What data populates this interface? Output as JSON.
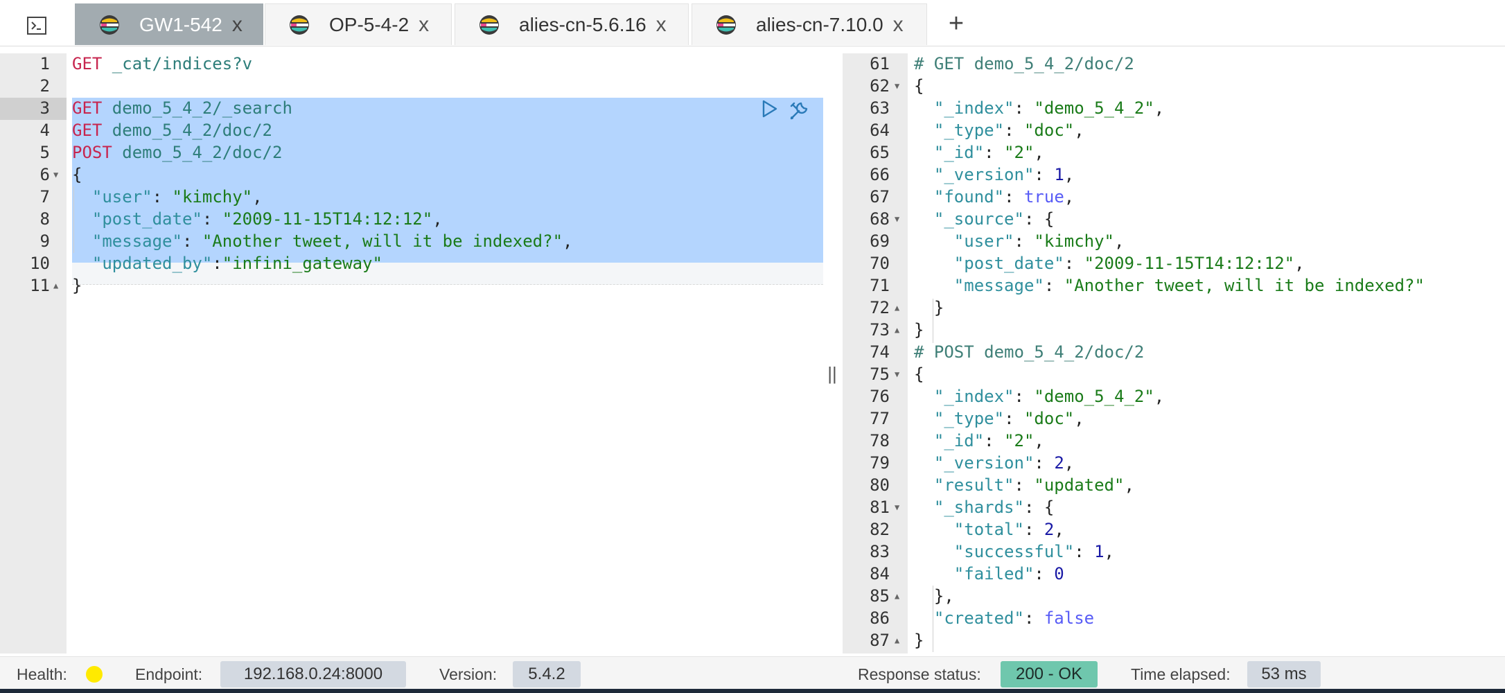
{
  "tabs": [
    {
      "label": "GW1-542",
      "active": true
    },
    {
      "label": "OP-5-4-2",
      "active": false
    },
    {
      "label": "alies-cn-5.6.16",
      "active": false
    },
    {
      "label": "alies-cn-7.10.0",
      "active": false
    }
  ],
  "tab_close_glyph": "x",
  "add_tab_glyph": "+",
  "request_editor": {
    "lines": [
      {
        "n": "1",
        "tokens": [
          [
            "method",
            "GET"
          ],
          [
            "url",
            " _cat/indices?v"
          ]
        ]
      },
      {
        "n": "2",
        "tokens": []
      },
      {
        "n": "3",
        "tokens": [
          [
            "method",
            "GET"
          ],
          [
            "url",
            " demo_5_4_2/_search"
          ]
        ]
      },
      {
        "n": "4",
        "tokens": [
          [
            "method",
            "GET"
          ],
          [
            "url",
            " demo_5_4_2/doc/2"
          ]
        ]
      },
      {
        "n": "5",
        "tokens": [
          [
            "method",
            "POST"
          ],
          [
            "url",
            " demo_5_4_2/doc/2"
          ]
        ]
      },
      {
        "n": "6",
        "fold": "open",
        "tokens": [
          [
            "punc",
            "{"
          ]
        ]
      },
      {
        "n": "7",
        "tokens": [
          [
            "punc",
            "  "
          ],
          [
            "key",
            "\"user\""
          ],
          [
            "punc",
            ": "
          ],
          [
            "str",
            "\"kimchy\""
          ],
          [
            "punc",
            ","
          ]
        ]
      },
      {
        "n": "8",
        "tokens": [
          [
            "punc",
            "  "
          ],
          [
            "key",
            "\"post_date\""
          ],
          [
            "punc",
            ": "
          ],
          [
            "str",
            "\"2009-11-15T14:12:12\""
          ],
          [
            "punc",
            ","
          ]
        ]
      },
      {
        "n": "9",
        "tokens": [
          [
            "punc",
            "  "
          ],
          [
            "key",
            "\"message\""
          ],
          [
            "punc",
            ": "
          ],
          [
            "str",
            "\"Another tweet, will it be indexed?\""
          ],
          [
            "punc",
            ","
          ]
        ]
      },
      {
        "n": "10",
        "tokens": [
          [
            "punc",
            "  "
          ],
          [
            "key",
            "\"updated_by\""
          ],
          [
            "punc",
            ":"
          ],
          [
            "str",
            "\"infini_gateway\""
          ]
        ]
      },
      {
        "n": "11",
        "fold": "close",
        "tokens": [
          [
            "punc",
            "}"
          ]
        ]
      }
    ]
  },
  "response_editor": {
    "lines": [
      {
        "n": "61",
        "tokens": [
          [
            "comment",
            "# GET demo_5_4_2/doc/2"
          ]
        ]
      },
      {
        "n": "62",
        "fold": "open",
        "tokens": [
          [
            "punc",
            "{"
          ]
        ]
      },
      {
        "n": "63",
        "tokens": [
          [
            "punc",
            "  "
          ],
          [
            "key",
            "\"_index\""
          ],
          [
            "punc",
            ": "
          ],
          [
            "str",
            "\"demo_5_4_2\""
          ],
          [
            "punc",
            ","
          ]
        ]
      },
      {
        "n": "64",
        "tokens": [
          [
            "punc",
            "  "
          ],
          [
            "key",
            "\"_type\""
          ],
          [
            "punc",
            ": "
          ],
          [
            "str",
            "\"doc\""
          ],
          [
            "punc",
            ","
          ]
        ]
      },
      {
        "n": "65",
        "tokens": [
          [
            "punc",
            "  "
          ],
          [
            "key",
            "\"_id\""
          ],
          [
            "punc",
            ": "
          ],
          [
            "str",
            "\"2\""
          ],
          [
            "punc",
            ","
          ]
        ]
      },
      {
        "n": "66",
        "tokens": [
          [
            "punc",
            "  "
          ],
          [
            "key",
            "\"_version\""
          ],
          [
            "punc",
            ": "
          ],
          [
            "num",
            "1"
          ],
          [
            "punc",
            ","
          ]
        ]
      },
      {
        "n": "67",
        "tokens": [
          [
            "punc",
            "  "
          ],
          [
            "key",
            "\"found\""
          ],
          [
            "punc",
            ": "
          ],
          [
            "kw",
            "true"
          ],
          [
            "punc",
            ","
          ]
        ]
      },
      {
        "n": "68",
        "fold": "open",
        "tokens": [
          [
            "punc",
            "  "
          ],
          [
            "key",
            "\"_source\""
          ],
          [
            "punc",
            ": {"
          ]
        ]
      },
      {
        "n": "69",
        "tokens": [
          [
            "punc",
            "    "
          ],
          [
            "key",
            "\"user\""
          ],
          [
            "punc",
            ": "
          ],
          [
            "str",
            "\"kimchy\""
          ],
          [
            "punc",
            ","
          ]
        ]
      },
      {
        "n": "70",
        "tokens": [
          [
            "punc",
            "    "
          ],
          [
            "key",
            "\"post_date\""
          ],
          [
            "punc",
            ": "
          ],
          [
            "str",
            "\"2009-11-15T14:12:12\""
          ],
          [
            "punc",
            ","
          ]
        ]
      },
      {
        "n": "71",
        "tokens": [
          [
            "punc",
            "    "
          ],
          [
            "key",
            "\"message\""
          ],
          [
            "punc",
            ": "
          ],
          [
            "str",
            "\"Another tweet, will it be indexed?\""
          ]
        ]
      },
      {
        "n": "72",
        "fold": "close",
        "tokens": [
          [
            "punc",
            "  }"
          ]
        ]
      },
      {
        "n": "73",
        "fold": "close",
        "tokens": [
          [
            "punc",
            "}"
          ]
        ]
      },
      {
        "n": "74",
        "tokens": [
          [
            "comment",
            "# POST demo_5_4_2/doc/2"
          ]
        ]
      },
      {
        "n": "75",
        "fold": "open",
        "tokens": [
          [
            "punc",
            "{"
          ]
        ]
      },
      {
        "n": "76",
        "tokens": [
          [
            "punc",
            "  "
          ],
          [
            "key",
            "\"_index\""
          ],
          [
            "punc",
            ": "
          ],
          [
            "str",
            "\"demo_5_4_2\""
          ],
          [
            "punc",
            ","
          ]
        ]
      },
      {
        "n": "77",
        "tokens": [
          [
            "punc",
            "  "
          ],
          [
            "key",
            "\"_type\""
          ],
          [
            "punc",
            ": "
          ],
          [
            "str",
            "\"doc\""
          ],
          [
            "punc",
            ","
          ]
        ]
      },
      {
        "n": "78",
        "tokens": [
          [
            "punc",
            "  "
          ],
          [
            "key",
            "\"_id\""
          ],
          [
            "punc",
            ": "
          ],
          [
            "str",
            "\"2\""
          ],
          [
            "punc",
            ","
          ]
        ]
      },
      {
        "n": "79",
        "tokens": [
          [
            "punc",
            "  "
          ],
          [
            "key",
            "\"_version\""
          ],
          [
            "punc",
            ": "
          ],
          [
            "num",
            "2"
          ],
          [
            "punc",
            ","
          ]
        ]
      },
      {
        "n": "80",
        "tokens": [
          [
            "punc",
            "  "
          ],
          [
            "key",
            "\"result\""
          ],
          [
            "punc",
            ": "
          ],
          [
            "str",
            "\"updated\""
          ],
          [
            "punc",
            ","
          ]
        ]
      },
      {
        "n": "81",
        "fold": "open",
        "tokens": [
          [
            "punc",
            "  "
          ],
          [
            "key",
            "\"_shards\""
          ],
          [
            "punc",
            ": {"
          ]
        ]
      },
      {
        "n": "82",
        "tokens": [
          [
            "punc",
            "    "
          ],
          [
            "key",
            "\"total\""
          ],
          [
            "punc",
            ": "
          ],
          [
            "num",
            "2"
          ],
          [
            "punc",
            ","
          ]
        ]
      },
      {
        "n": "83",
        "tokens": [
          [
            "punc",
            "    "
          ],
          [
            "key",
            "\"successful\""
          ],
          [
            "punc",
            ": "
          ],
          [
            "num",
            "1"
          ],
          [
            "punc",
            ","
          ]
        ]
      },
      {
        "n": "84",
        "tokens": [
          [
            "punc",
            "    "
          ],
          [
            "key",
            "\"failed\""
          ],
          [
            "punc",
            ": "
          ],
          [
            "num",
            "0"
          ]
        ]
      },
      {
        "n": "85",
        "fold": "close",
        "tokens": [
          [
            "punc",
            "  },"
          ]
        ]
      },
      {
        "n": "86",
        "tokens": [
          [
            "punc",
            "  "
          ],
          [
            "key",
            "\"created\""
          ],
          [
            "punc",
            ": "
          ],
          [
            "kw",
            "false"
          ]
        ]
      },
      {
        "n": "87",
        "fold": "close",
        "tokens": [
          [
            "punc",
            "}"
          ]
        ]
      }
    ]
  },
  "status": {
    "health_label": "Health:",
    "health_color": "#ffea00",
    "endpoint_label": "Endpoint:",
    "endpoint_value": "192.168.0.24:8000",
    "version_label": "Version:",
    "version_value": "5.4.2",
    "response_status_label": "Response status:",
    "response_status_value": "200 - OK",
    "time_elapsed_label": "Time elapsed:",
    "time_elapsed_value": "53 ms"
  },
  "colors": {
    "active_tab": "#a2abb0",
    "selection": "#b4d5fe",
    "status_ok": "#6fc7ad",
    "pill": "#d3d9e1"
  },
  "icons": {
    "console": "terminal-icon",
    "tab_logo": "elastic-logo-icon",
    "run": "play-icon",
    "settings": "wrench-icon"
  }
}
